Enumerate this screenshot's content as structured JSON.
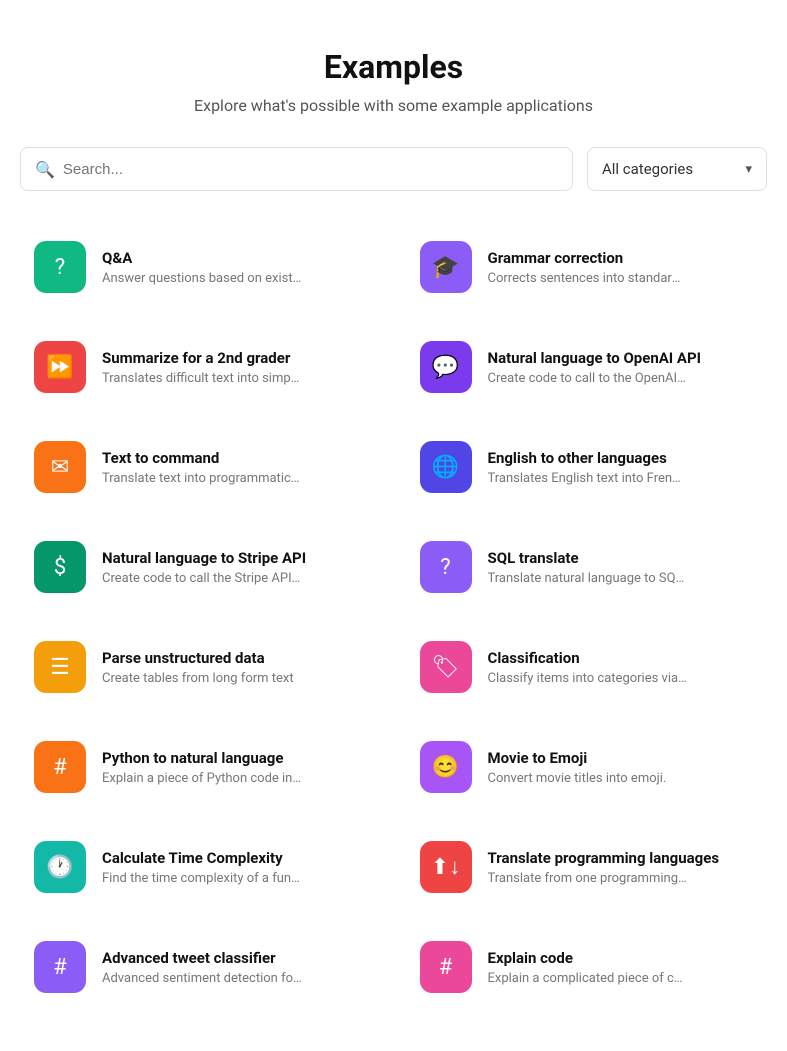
{
  "header": {
    "title": "Examples",
    "subtitle": "Explore what's possible with some example applications"
  },
  "search": {
    "placeholder": "Search...",
    "value": ""
  },
  "filter": {
    "label": "All categories",
    "chevron": "▾"
  },
  "examples": [
    {
      "id": "qa",
      "title": "Q&A",
      "desc": "Answer questions based on existing knowle...",
      "icon": "?",
      "bg": "bg-teal",
      "col": "left"
    },
    {
      "id": "grammar",
      "title": "Grammar correction",
      "desc": "Corrects sentences into standard English.",
      "icon": "🎓",
      "bg": "bg-purple",
      "col": "right"
    },
    {
      "id": "summarize",
      "title": "Summarize for a 2nd grader",
      "desc": "Translates difficult text into simpler concep...",
      "icon": "⏩",
      "bg": "bg-red",
      "col": "left"
    },
    {
      "id": "nl-openai",
      "title": "Natural language to OpenAI API",
      "desc": "Create code to call to the OpenAI API usin...",
      "icon": "💬",
      "bg": "bg-violet",
      "col": "right"
    },
    {
      "id": "text-command",
      "title": "Text to command",
      "desc": "Translate text into programmatic commands.",
      "icon": "✉",
      "bg": "bg-orange",
      "col": "left"
    },
    {
      "id": "english-lang",
      "title": "English to other languages",
      "desc": "Translates English text into French, Spanish...",
      "icon": "🌐",
      "bg": "bg-indigo",
      "col": "right"
    },
    {
      "id": "nl-stripe",
      "title": "Natural language to Stripe API",
      "desc": "Create code to call the Stripe API using nat...",
      "icon": "$",
      "bg": "bg-green-dark",
      "col": "left"
    },
    {
      "id": "sql-translate",
      "title": "SQL translate",
      "desc": "Translate natural language to SQL queries.",
      "icon": "?",
      "bg": "bg-purple",
      "col": "right"
    },
    {
      "id": "parse-data",
      "title": "Parse unstructured data",
      "desc": "Create tables from long form text",
      "icon": "☰",
      "bg": "bg-orange2",
      "col": "left"
    },
    {
      "id": "classification",
      "title": "Classification",
      "desc": "Classify items into categories via example.",
      "icon": "🏷",
      "bg": "bg-pink",
      "col": "right"
    },
    {
      "id": "python-nl",
      "title": "Python to natural language",
      "desc": "Explain a piece of Python code in human un...",
      "icon": "#",
      "bg": "bg-orange3",
      "col": "left"
    },
    {
      "id": "movie-emoji",
      "title": "Movie to Emoji",
      "desc": "Convert movie titles into emoji.",
      "icon": "😊",
      "bg": "bg-purple2",
      "col": "right"
    },
    {
      "id": "time-complexity",
      "title": "Calculate Time Complexity",
      "desc": "Find the time complexity of a function.",
      "icon": "🕐",
      "bg": "bg-teal2",
      "col": "left"
    },
    {
      "id": "translate-prog",
      "title": "Translate programming languages",
      "desc": "Translate from one programming language ...",
      "icon": "⬆↓",
      "bg": "bg-red2",
      "col": "right"
    },
    {
      "id": "tweet-classifier",
      "title": "Advanced tweet classifier",
      "desc": "Advanced sentiment detection for a piece o...",
      "icon": "#",
      "bg": "bg-purple",
      "col": "left"
    },
    {
      "id": "explain-code",
      "title": "Explain code",
      "desc": "Explain a complicated piece of code.",
      "icon": "#",
      "bg": "bg-pink2",
      "col": "right"
    }
  ]
}
